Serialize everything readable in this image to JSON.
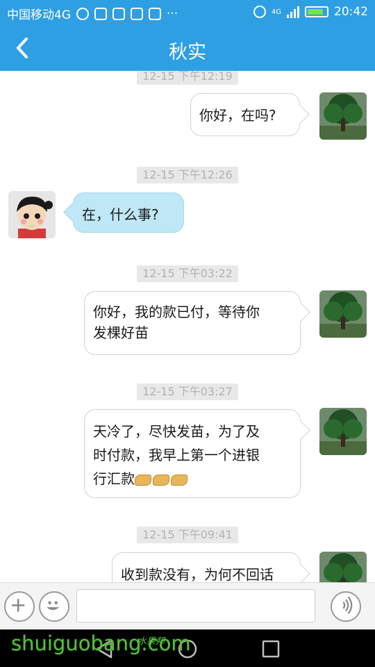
{
  "status_bar": {
    "carrier": "中国移动4G",
    "network_type": "4G",
    "time": "20:42",
    "more": "···"
  },
  "header": {
    "title": "秋实",
    "back_icon": "chevron-left-icon"
  },
  "messages": [
    {
      "timestamp": "12-15 下午12:19",
      "direction": "out",
      "lines": [
        "你好，在吗?"
      ]
    },
    {
      "timestamp": "12-15 下午12:26",
      "direction": "in",
      "lines": [
        "在，什么事?"
      ]
    },
    {
      "timestamp": "12-15 下午03:22",
      "direction": "out",
      "lines": [
        "你好，我的款已付，等待你",
        "发棵好苗"
      ]
    },
    {
      "timestamp": "12-15 下午03:27",
      "direction": "out",
      "lines": [
        "天冷了，尽快发苗，为了及",
        "时付款，我早上第一个进银",
        "行汇款"
      ]
    },
    {
      "timestamp": "12-15 下午09:41",
      "direction": "out",
      "lines": [
        "收到款没有，为何不回话"
      ]
    }
  ],
  "input_bar": {
    "placeholder": "",
    "value": ""
  },
  "watermark": {
    "text": "shuiguobang.com",
    "cn": "水果邦"
  },
  "colors": {
    "accent": "#2f9fe3",
    "incoming_bubble": "#bfe7f5",
    "timestamp_bg": "#e8e8e8",
    "watermark": "#55c23a"
  }
}
